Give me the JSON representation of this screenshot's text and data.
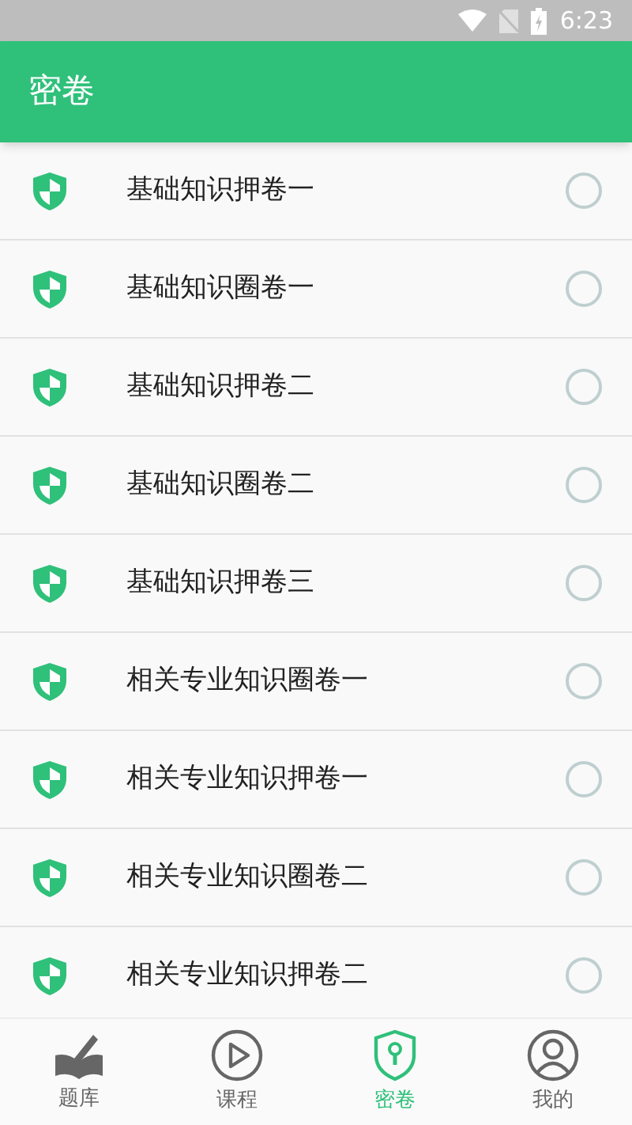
{
  "status_bar": {
    "time": "6:23"
  },
  "header": {
    "title": "密卷"
  },
  "papers": [
    {
      "title": "基础知识押卷一",
      "selected": false
    },
    {
      "title": "基础知识圈卷一",
      "selected": false
    },
    {
      "title": "基础知识押卷二",
      "selected": false
    },
    {
      "title": "基础知识圈卷二",
      "selected": false
    },
    {
      "title": "基础知识押卷三",
      "selected": false
    },
    {
      "title": "相关专业知识圈卷一",
      "selected": false
    },
    {
      "title": "相关专业知识押卷一",
      "selected": false
    },
    {
      "title": "相关专业知识圈卷二",
      "selected": false
    },
    {
      "title": "相关专业知识押卷二",
      "selected": false
    }
  ],
  "bottom_nav": [
    {
      "label": "题库",
      "kind": "book",
      "selected": false
    },
    {
      "label": "课程",
      "kind": "play",
      "selected": false
    },
    {
      "label": "密卷",
      "kind": "shield",
      "selected": true
    },
    {
      "label": "我的",
      "kind": "user",
      "selected": false
    }
  ]
}
